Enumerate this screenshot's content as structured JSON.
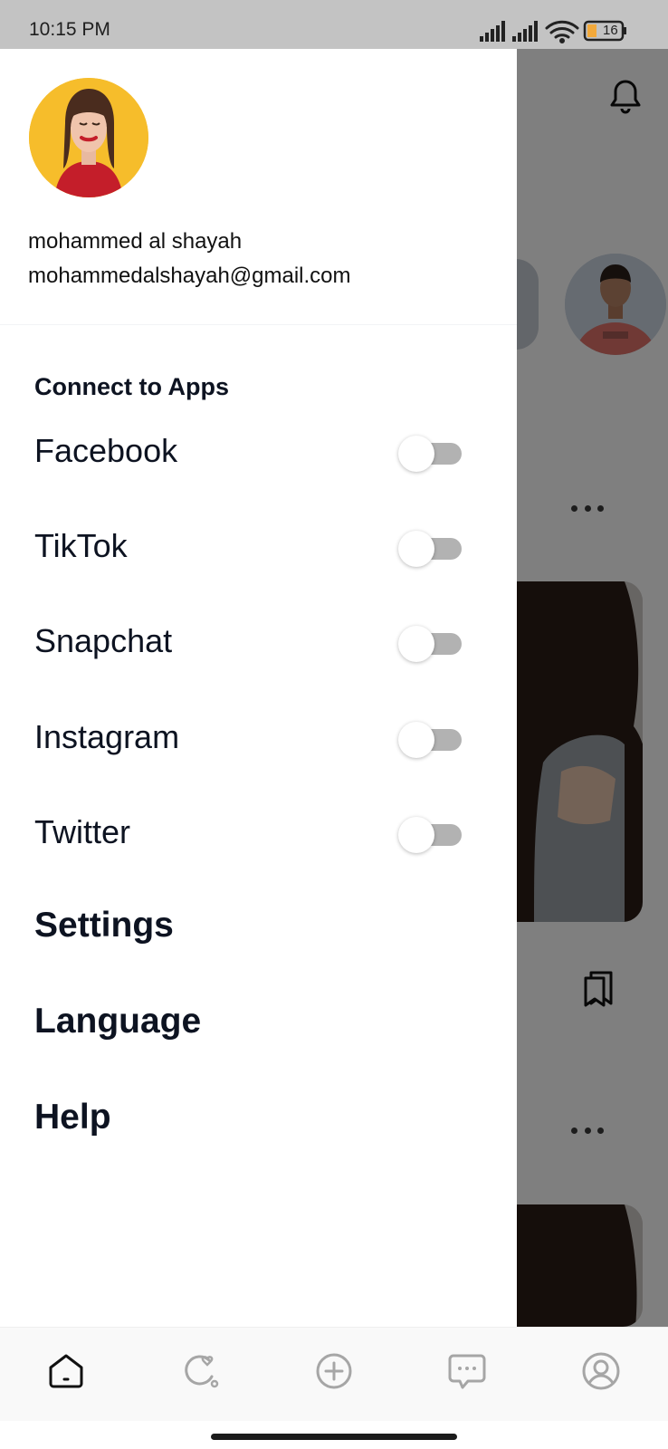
{
  "status_bar": {
    "time": "10:15 PM",
    "battery": "16"
  },
  "profile": {
    "name": "mohammed al shayah",
    "email": "mohammedalshayah@gmail.com"
  },
  "connect_section": {
    "title": "Connect to Apps",
    "apps": [
      {
        "label": "Facebook",
        "connected": false
      },
      {
        "label": "TikTok",
        "connected": false
      },
      {
        "label": "Snapchat",
        "connected": false
      },
      {
        "label": "Instagram",
        "connected": false
      },
      {
        "label": "Twitter",
        "connected": false
      }
    ]
  },
  "menu": {
    "settings": "Settings",
    "language": "Language",
    "help": "Help"
  },
  "bottom_nav": {
    "items": [
      "home-icon",
      "activity-icon",
      "add-post-icon",
      "messages-icon",
      "profile-icon"
    ],
    "active": "home-icon"
  },
  "colors": {
    "text_dark": "#0d1321",
    "toggle_off_track": "#b2b2b2",
    "avatar_bg": "#f6bd2b",
    "status_bar_bg": "#c3c3c3"
  }
}
